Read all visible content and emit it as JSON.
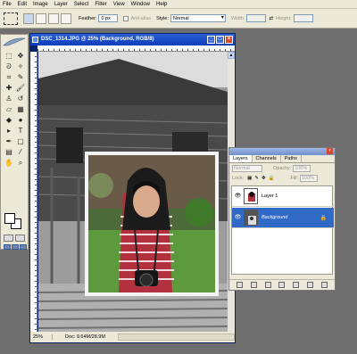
{
  "menu": [
    "File",
    "Edit",
    "Image",
    "Layer",
    "Select",
    "Filter",
    "View",
    "Window",
    "Help"
  ],
  "options": {
    "feather_label": "Feather:",
    "feather_value": "0 px",
    "antialias_label": "Anti-alias",
    "style_label": "Style:",
    "style_value": "Normal",
    "width_label": "Width:",
    "height_label": "Height:"
  },
  "document": {
    "title": "DSC_1314.JPG @ 25% (Background, RGB/8)",
    "zoom": "25%",
    "doc_info": "Doc: 9.64M/28.9M"
  },
  "layers_panel": {
    "tabs": [
      "Layers",
      "Channels",
      "Paths"
    ],
    "active_tab": "Layers",
    "blend_mode": "Normal",
    "opacity_label": "Opacity:",
    "opacity_value": "100%",
    "lock_label": "Lock:",
    "fill_label": "Fill:",
    "fill_value": "100%",
    "layers": [
      {
        "name": "Layer 1",
        "selected": false
      },
      {
        "name": "Background",
        "selected": true,
        "locked": true
      }
    ]
  },
  "colors": {
    "titlebar": "#0a3db8",
    "selection": "#3169c6",
    "workspace": "#6e6e6e",
    "panel": "#ece9d8"
  }
}
